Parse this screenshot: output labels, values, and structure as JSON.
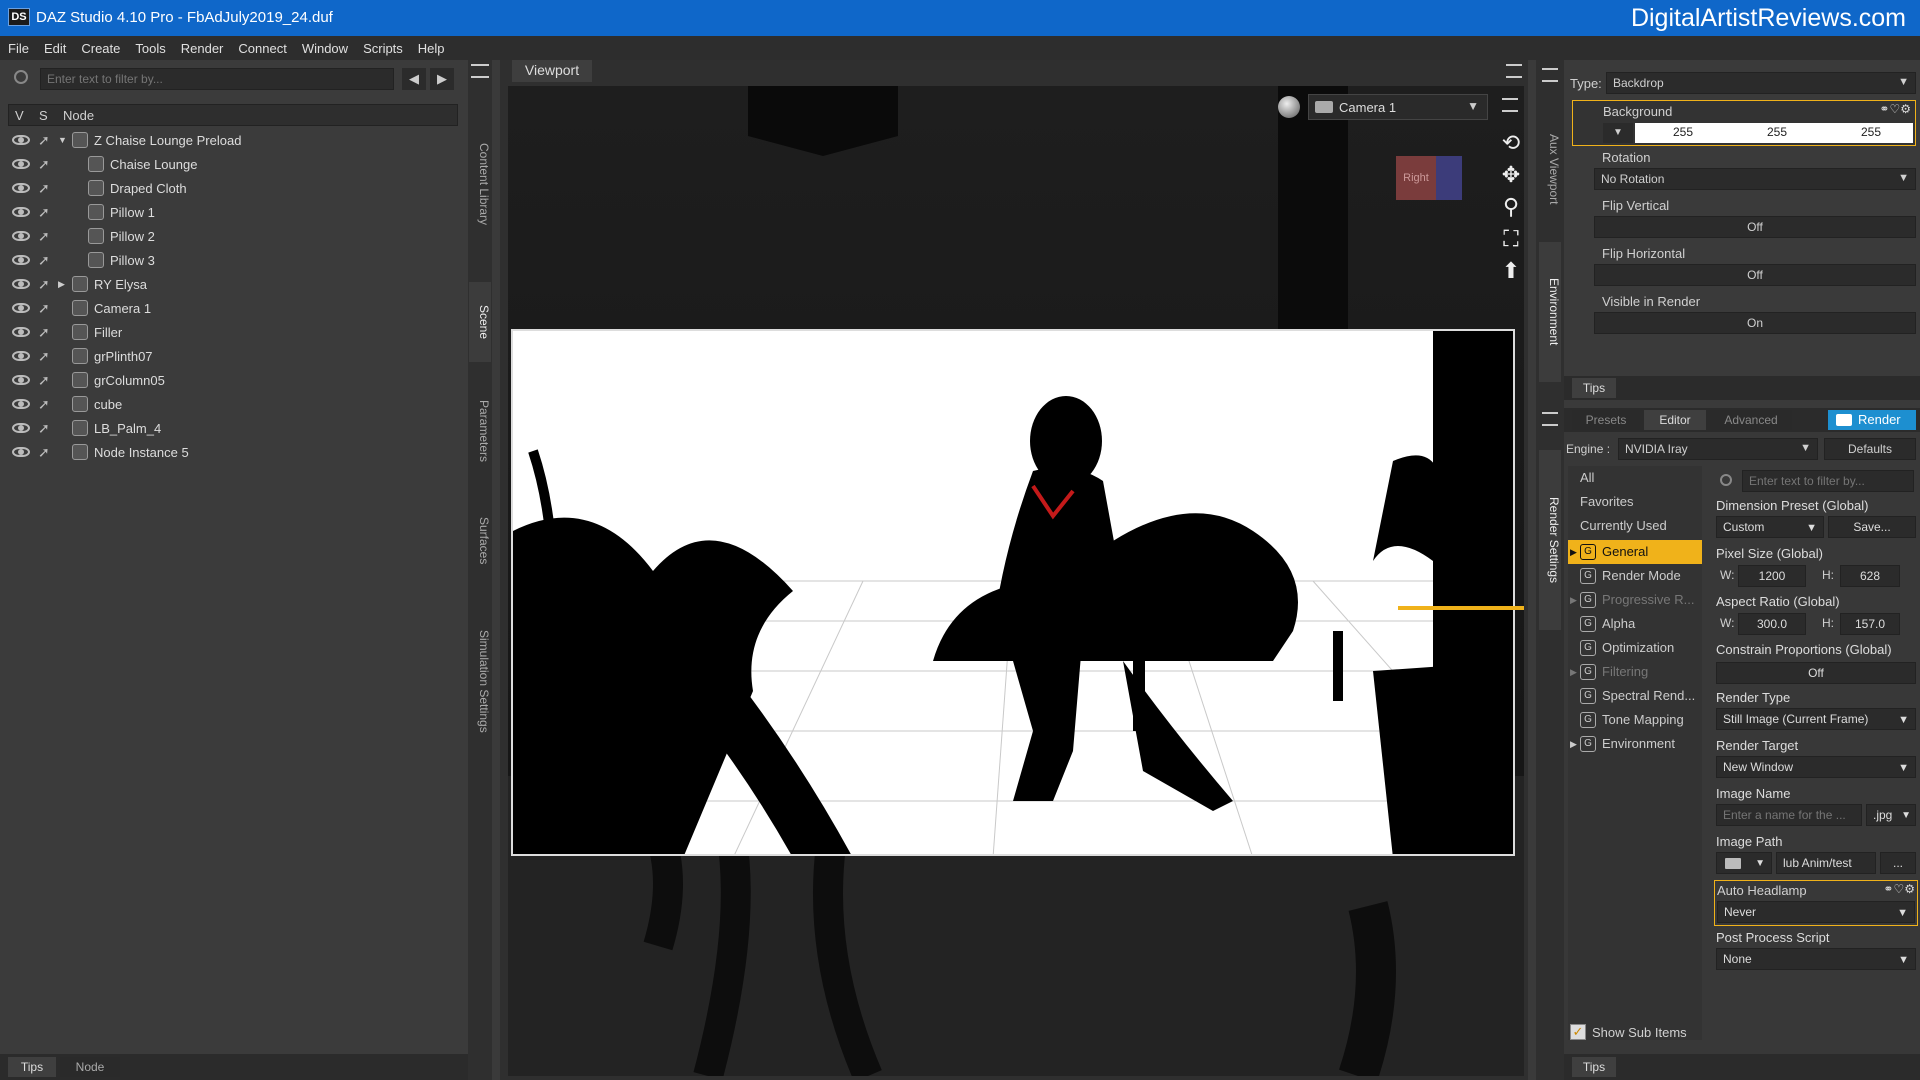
{
  "app": {
    "title": "DAZ Studio 4.10 Pro - FbAdJuly2019_24.duf",
    "logo": "DS",
    "watermark": "DigitalArtistReviews.com"
  },
  "menu": [
    "File",
    "Edit",
    "Create",
    "Tools",
    "Render",
    "Connect",
    "Window",
    "Scripts",
    "Help"
  ],
  "scene": {
    "filter_placeholder": "Enter text to filter by...",
    "col_v": "V",
    "col_s": "S",
    "col_node": "Node",
    "nodes": [
      {
        "label": "Z Chaise Lounge Preload",
        "indent": 0,
        "expander": "▼"
      },
      {
        "label": "Chaise Lounge",
        "indent": 1
      },
      {
        "label": "Draped Cloth",
        "indent": 1
      },
      {
        "label": "Pillow 1",
        "indent": 1
      },
      {
        "label": "Pillow 2",
        "indent": 1
      },
      {
        "label": "Pillow 3",
        "indent": 1
      },
      {
        "label": "RY Elysa",
        "indent": 0,
        "expander": "▶"
      },
      {
        "label": "Camera 1",
        "indent": 0
      },
      {
        "label": "Filler",
        "indent": 0
      },
      {
        "label": "grPlinth07",
        "indent": 0
      },
      {
        "label": "grColumn05",
        "indent": 0
      },
      {
        "label": "cube",
        "indent": 0
      },
      {
        "label": "LB_Palm_4",
        "indent": 0
      },
      {
        "label": "Node Instance 5",
        "indent": 0
      }
    ],
    "bottom_tabs": [
      "Tips",
      "Node"
    ]
  },
  "left_vtabs": [
    "Content Library",
    "Scene",
    "Parameters",
    "Surfaces",
    "Simulation Settings"
  ],
  "viewport": {
    "tab": "Viewport",
    "camera": "Camera 1",
    "cube_label": "Right"
  },
  "env": {
    "type_label": "Type:",
    "type_value": "Backdrop",
    "background_label": "Background",
    "bg_r": "255",
    "bg_g": "255",
    "bg_b": "255",
    "rotation_label": "Rotation",
    "rotation_value": "No Rotation",
    "flipv_label": "Flip Vertical",
    "flipv_value": "Off",
    "fliph_label": "Flip Horizontal",
    "fliph_value": "Off",
    "visible_label": "Visible in Render",
    "visible_value": "On",
    "tips": "Tips"
  },
  "right_vtabs": [
    "Aux Viewport",
    "Environment",
    "Render Settings"
  ],
  "render": {
    "tabs": [
      "Presets",
      "Editor",
      "Advanced"
    ],
    "render_button": "Render",
    "engine_label": "Engine :",
    "engine_value": "NVIDIA Iray",
    "defaults": "Defaults",
    "filter_placeholder": "Enter text to filter by...",
    "groups": [
      "All",
      "Favorites",
      "Currently Used"
    ],
    "sections": [
      {
        "label": "General",
        "expander": "▶",
        "active": true
      },
      {
        "label": "Render Mode"
      },
      {
        "label": "Progressive R...",
        "expander": "▶",
        "dim": true
      },
      {
        "label": "Alpha"
      },
      {
        "label": "Optimization"
      },
      {
        "label": "Filtering",
        "expander": "▶",
        "dim": true
      },
      {
        "label": "Spectral Rend..."
      },
      {
        "label": "Tone Mapping"
      },
      {
        "label": "Environment",
        "expander": "▶"
      }
    ],
    "section_icon": "G",
    "dimension_preset_label": "Dimension Preset (Global)",
    "dimension_preset_value": "Custom",
    "save": "Save...",
    "pixel_size_label": "Pixel Size (Global)",
    "pixel_w": "1200",
    "pixel_h": "628",
    "aspect_label": "Aspect Ratio (Global)",
    "aspect_w": "300.0",
    "aspect_h": "157.0",
    "w_label": "W:",
    "h_label": "H:",
    "constrain_label": "Constrain Proportions (Global)",
    "constrain_value": "Off",
    "render_type_label": "Render Type",
    "render_type_value": "Still Image (Current Frame)",
    "render_target_label": "Render Target",
    "render_target_value": "New Window",
    "image_name_label": "Image Name",
    "image_name_placeholder": "Enter a name for the ...",
    "image_ext": ".jpg",
    "image_path_label": "Image Path",
    "image_path_value": "lub Anim/test",
    "path_more": "...",
    "headlamp_label": "Auto Headlamp",
    "headlamp_value": "Never",
    "post_label": "Post Process Script",
    "post_value": "None",
    "show_sub": "Show Sub Items",
    "tips": "Tips"
  },
  "colors": {
    "title": "#0f67c9",
    "accent": "#f0b21a",
    "render_btn": "#1d8fd0"
  }
}
